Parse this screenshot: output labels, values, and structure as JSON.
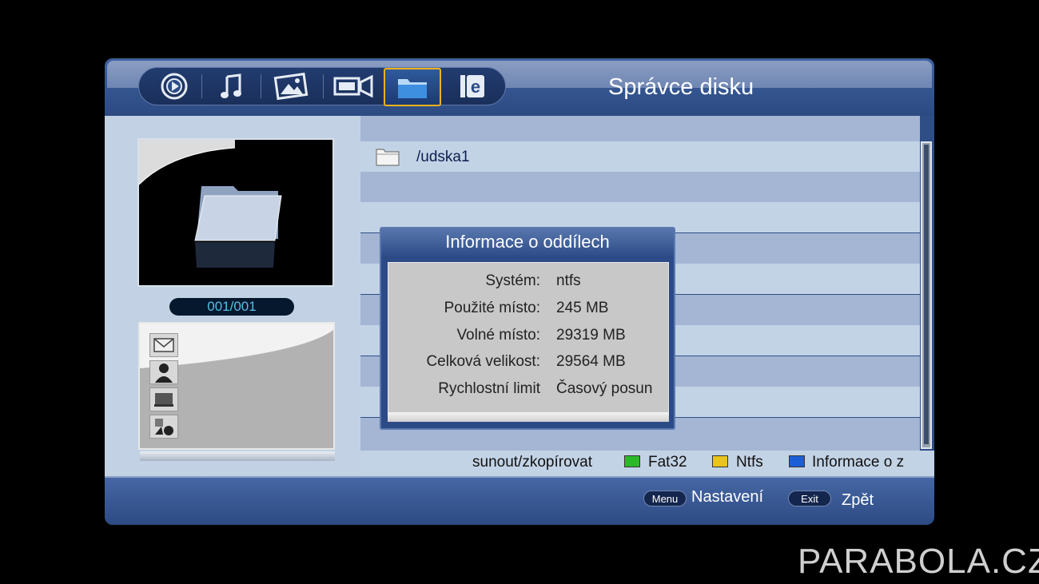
{
  "header": {
    "title": "Správce disku",
    "tabs": [
      {
        "icon": "media-player-icon"
      },
      {
        "icon": "music-note-icon"
      },
      {
        "icon": "photo-icon"
      },
      {
        "icon": "video-camera-icon"
      },
      {
        "icon": "folder-icon",
        "active": true
      },
      {
        "icon": "e-book-icon"
      }
    ]
  },
  "preview": {
    "counter": "001/001"
  },
  "thumbs": [
    {
      "icon": "mail-icon"
    },
    {
      "icon": "person-icon"
    },
    {
      "icon": "monitor-icon"
    },
    {
      "icon": "shapes-icon"
    }
  ],
  "list": {
    "items": [
      {
        "name": "/udska1",
        "icon": "folder-icon"
      }
    ]
  },
  "legend": {
    "move_copy": "sunout/zkopírovat",
    "green": {
      "label": "Fat32",
      "color": "#2db82a"
    },
    "yellow": {
      "label": "Ntfs",
      "color": "#e8c41c"
    },
    "blue": {
      "label": "Informace o z",
      "color": "#1b5fd6"
    }
  },
  "dialog": {
    "title": "Informace o oddílech",
    "rows": [
      {
        "label": "Systém:",
        "value": "ntfs"
      },
      {
        "label": "Použité místo:",
        "value": "245 MB"
      },
      {
        "label": "Volné místo:",
        "value": "29319 MB"
      },
      {
        "label": "Celková velikost:",
        "value": "29564 MB"
      },
      {
        "label": "Rychlostní limit",
        "value": "Časový posun"
      }
    ]
  },
  "footer": {
    "menu_key": "Menu",
    "menu_label": "Nastavení",
    "exit_key": "Exit",
    "exit_label": "Zpět"
  },
  "watermark": "PARABOLA.CZ"
}
